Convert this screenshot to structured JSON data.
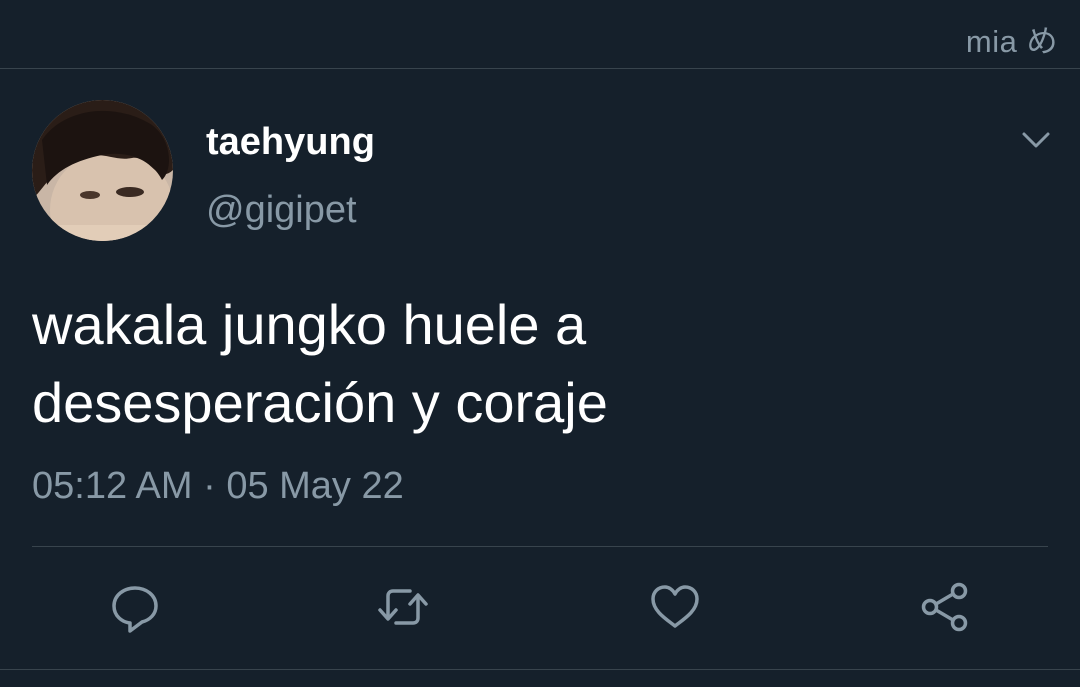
{
  "watermark": "mia め",
  "author": {
    "display_name": "taehyung",
    "handle": "@gigipet"
  },
  "tweet": {
    "text_lines": [
      "wakala jungko huele a",
      "desesperación y coraje"
    ],
    "timestamp": "05:12 AM · 05 May 22"
  },
  "actions": {
    "reply_icon": "reply-icon",
    "retweet_icon": "retweet-icon",
    "like_icon": "heart-icon",
    "share_icon": "share-icon"
  },
  "colors": {
    "background": "#15202b",
    "secondary_text": "#8899a6",
    "divider": "#38444d",
    "primary_text": "#ffffff"
  }
}
